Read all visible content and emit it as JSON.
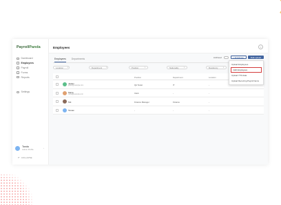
{
  "app": {
    "logo_part1": "Payroll",
    "logo_part2": "Panda",
    "accent": "#41649f",
    "highlight": "#d43a3a"
  },
  "sidebar": {
    "items": [
      {
        "label": "Dashboard",
        "icon": "dashboard-icon"
      },
      {
        "label": "Employees",
        "icon": "users-icon",
        "active": true
      },
      {
        "label": "Payroll",
        "icon": "payroll-icon"
      },
      {
        "label": "Forms",
        "icon": "forms-icon"
      },
      {
        "label": "Reports",
        "icon": "reports-icon"
      }
    ],
    "settings_label": "Settings",
    "user": {
      "name": "Tanda",
      "role": "Admin Profile"
    },
    "collapse_label": "COLLAPSE"
  },
  "header": {
    "title": "Employees"
  },
  "tabs": [
    {
      "label": "Employees",
      "active": true
    },
    {
      "label": "Departments"
    }
  ],
  "actions": {
    "archived_label": "Archived",
    "add_label": "+ Employee",
    "bulk_label": "Bulk upload"
  },
  "filters": [
    {
      "label": "Location"
    },
    {
      "label": "Department"
    },
    {
      "label": "Position"
    },
    {
      "label": "Nationality"
    },
    {
      "label": "Residency"
    }
  ],
  "table": {
    "columns": [
      "Position",
      "Department",
      "Location"
    ],
    "rows": [
      {
        "name": "Jaiden",
        "email": "jaiden@example.com",
        "position": "QA Tester",
        "department": "IT",
        "location": "-",
        "avatar_color": "#5bbf8a"
      },
      {
        "name": "Maria",
        "email": "maria@example.com",
        "position": "Clerk",
        "department": "-",
        "location": "-",
        "avatar_color": "#e0a070"
      },
      {
        "name": "Nik",
        "email": "",
        "position": "Finance Manager",
        "department": "Finance",
        "location": "-",
        "avatar_color": "#8a6a5a"
      },
      {
        "name": "Tanaw",
        "email": "",
        "position": "-",
        "department": "-",
        "location": "-",
        "avatar_color": "#7db4f1"
      }
    ]
  },
  "dropdown": {
    "items": [
      {
        "label": "Upload Employees"
      },
      {
        "label": "Edit Employees",
        "active": true
      },
      {
        "label": "Upload YTD data"
      },
      {
        "label": "Upload Recurring Payroll Items"
      }
    ]
  }
}
